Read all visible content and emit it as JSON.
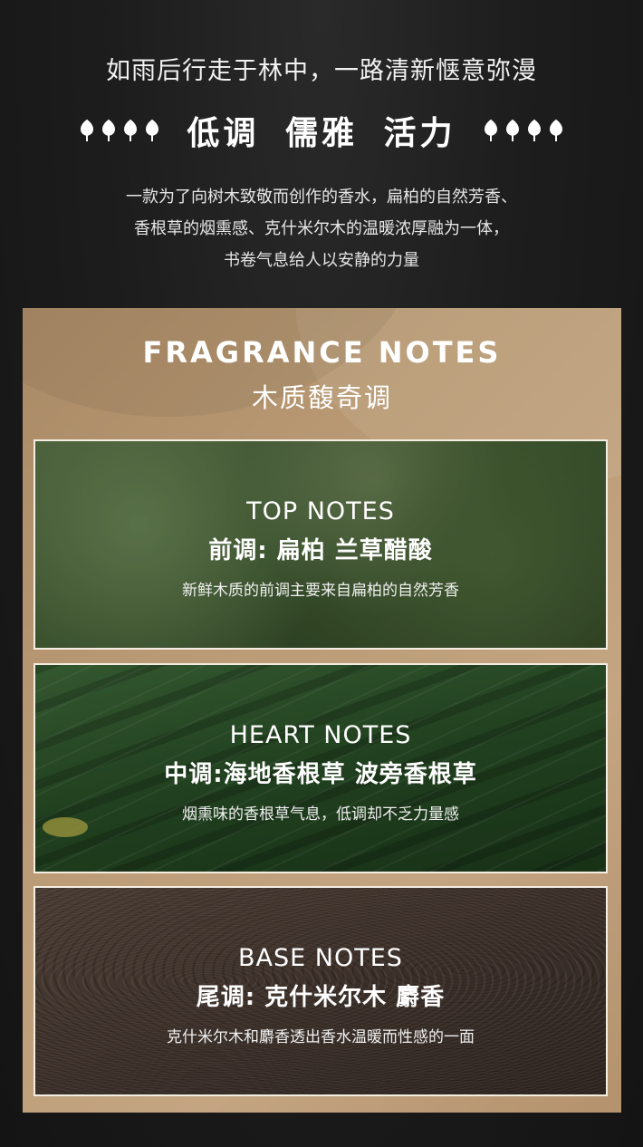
{
  "header": {
    "headline": "如雨后行走于林中，一路清新惬意弥漫",
    "tagline": [
      "低调",
      "儒雅",
      "活力"
    ],
    "description_lines": [
      "一款为了向树木致敬而创作的香水，扁柏的自然芳香、",
      "香根草的烟熏感、克什米尔木的温暖浓厚融为一体，",
      "书卷气息给人以安静的力量"
    ]
  },
  "panel": {
    "title_en": "FRAGRANCE NOTES",
    "title_cn": "木质馥奇调",
    "notes": [
      {
        "en": "TOP NOTES",
        "cn": "前调: 扁柏 兰草醋酸",
        "desc": "新鲜木质的前调主要来自扁柏的自然芳香"
      },
      {
        "en": "HEART NOTES",
        "cn": "中调:海地香根草 波旁香根草",
        "desc": "烟熏味的香根草气息，低调却不乏力量感"
      },
      {
        "en": "BASE NOTES",
        "cn": "尾调: 克什米尔木 麝香",
        "desc": "克什米尔木和麝香透出香水温暖而性感的一面"
      }
    ]
  },
  "icons": {
    "decoration": "leaf-icon"
  },
  "colors": {
    "panel": "#b99a74",
    "background": "#1d1d1d",
    "frame": "#f4ede2"
  }
}
